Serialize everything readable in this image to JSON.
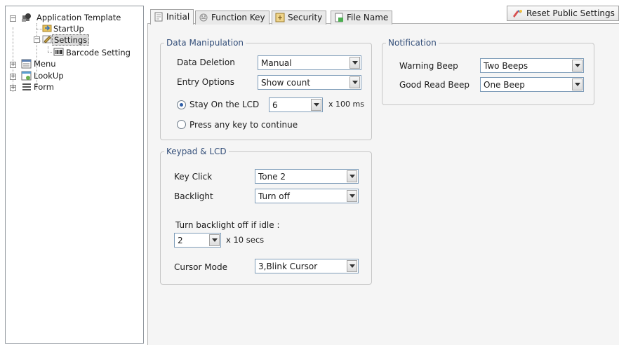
{
  "tree": {
    "root": "Application Template",
    "startup": "StartUp",
    "settings": "Settings",
    "barcode": "Barcode Setting",
    "menu": "Menu",
    "lookup": "LookUp",
    "form": "Form"
  },
  "tabs": {
    "initial": "Initial",
    "function_key": "Function Key",
    "security": "Security",
    "file_name": "File Name"
  },
  "toolbar": {
    "reset": "Reset Public Settings"
  },
  "data_manipulation": {
    "title": "Data Manipulation",
    "deletion_label": "Data Deletion",
    "deletion_value": "Manual",
    "entry_label": "Entry Options",
    "entry_value": "Show count",
    "stay_label": "Stay On the LCD",
    "stay_value": "6",
    "stay_unit": "x 100 ms",
    "press_label": "Press any key to continue"
  },
  "keypad": {
    "title": "Keypad & LCD",
    "keyclick_label": "Key Click",
    "keyclick_value": "Tone 2",
    "backlight_label": "Backlight",
    "backlight_value": "Turn off",
    "idle_label": "Turn backlight off if idle :",
    "idle_value": "2",
    "idle_unit": "x 10 secs",
    "cursor_label": "Cursor Mode",
    "cursor_value": "3,Blink Cursor"
  },
  "notification": {
    "title": "Notification",
    "warning_label": "Warning Beep",
    "warning_value": "Two Beeps",
    "goodread_label": "Good Read Beep",
    "goodread_value": "One Beep"
  },
  "colors": {
    "legend": "#35507a",
    "radio_dot": "#2f5fa8",
    "combo_border": "#7f9db9"
  }
}
